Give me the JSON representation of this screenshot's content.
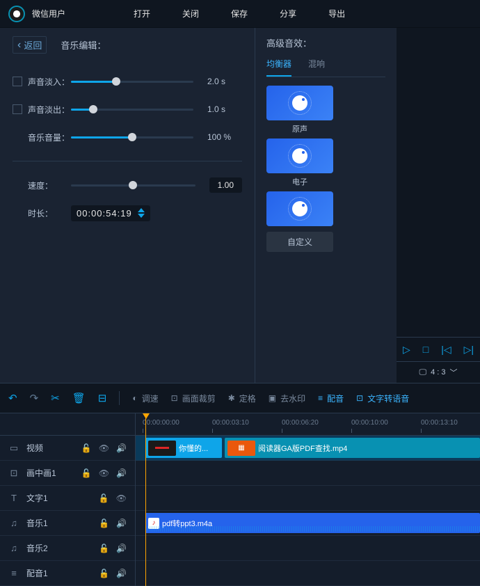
{
  "topbar": {
    "username": "微信用户",
    "menu": [
      "打开",
      "关闭",
      "保存",
      "分享",
      "导出"
    ]
  },
  "editor": {
    "back": "返回",
    "title": "音乐编辑：",
    "fade_in_label": "声音淡入：",
    "fade_in_value": "2.0 s",
    "fade_in_pct": 37,
    "fade_out_label": "声音淡出：",
    "fade_out_value": "1.0 s",
    "fade_out_pct": 18,
    "volume_label": "音乐音量：",
    "volume_value": "100 %",
    "volume_pct": 50,
    "speed_label": "速度：",
    "speed_value": "1.00",
    "speed_pct": 50,
    "duration_label": "时长：",
    "duration_value": "00:00:54:19"
  },
  "effects": {
    "title": "高级音效：",
    "tabs": [
      "均衡器",
      "混响"
    ],
    "presets": [
      "原声",
      "电子",
      ""
    ],
    "custom": "自定义"
  },
  "preview": {
    "aspect": "4 : 3"
  },
  "toolbar": {
    "items": [
      "调速",
      "画面裁剪",
      "定格",
      "去水印",
      "配音",
      "文字转语音"
    ]
  },
  "ruler": [
    "00:00:00:00",
    "00:00:03:10",
    "00:00:06:20",
    "00:00:10:00",
    "00:00:13:10"
  ],
  "tracks": {
    "video": "视频",
    "pip1": "画中画1",
    "text1": "文字1",
    "music1": "音乐1",
    "music2": "音乐2",
    "vo1": "配音1"
  },
  "clips": {
    "video1": "你懂的...",
    "video2": "阅读器GA版PDF查找.mp4",
    "audio1": "pdf转ppt3.m4a"
  }
}
